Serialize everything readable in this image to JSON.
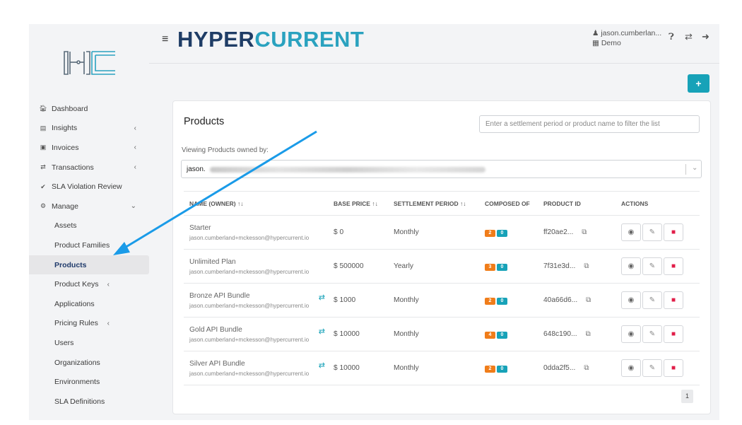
{
  "brand": {
    "part1": "HYPER",
    "part2": "CURRENT"
  },
  "user": {
    "name": "jason.cumberlan...",
    "org": "Demo"
  },
  "sidebar": {
    "items": [
      {
        "label": "Dashboard",
        "icon": "home-icon",
        "chevron": ""
      },
      {
        "label": "Insights",
        "icon": "bar-chart-icon",
        "chevron": "‹"
      },
      {
        "label": "Invoices",
        "icon": "invoice-icon",
        "chevron": "‹"
      },
      {
        "label": "Transactions",
        "icon": "transfer-icon",
        "chevron": "‹"
      },
      {
        "label": "SLA Violation Review",
        "icon": "check-icon",
        "chevron": ""
      },
      {
        "label": "Manage",
        "icon": "gear-icon",
        "chevron": "⌄"
      },
      {
        "label": "Assets",
        "chevron": ""
      },
      {
        "label": "Product Families",
        "chevron": ""
      },
      {
        "label": "Products",
        "chevron": "",
        "active": true
      },
      {
        "label": "Product Keys",
        "chevron": "‹"
      },
      {
        "label": "Applications",
        "chevron": ""
      },
      {
        "label": "Pricing Rules",
        "chevron": "‹"
      },
      {
        "label": "Users",
        "chevron": ""
      },
      {
        "label": "Organizations",
        "chevron": ""
      },
      {
        "label": "Environments",
        "chevron": ""
      },
      {
        "label": "SLA Definitions",
        "chevron": ""
      }
    ]
  },
  "products": {
    "title": "Products",
    "filter_placeholder": "Enter a settlement period or product name to filter the list",
    "owner_label": "Viewing Products owned by:",
    "owner_value": "jason.",
    "columns": {
      "name": "NAME (OWNER) ↑↓",
      "base_price": "BASE PRICE ↑↓",
      "settlement_period": "SETTLEMENT PERIOD ↑↓",
      "composed_of": "COMPOSED OF",
      "product_id": "PRODUCT ID",
      "actions": "ACTIONS"
    },
    "rows": [
      {
        "name": "Starter",
        "owner": "jason.cumberland+mckesson@hypercurrent.io",
        "price": "$ 0",
        "period": "Monthly",
        "c1": "2",
        "c2": "0",
        "id": "ff20ae2...",
        "sync": false
      },
      {
        "name": "Unlimited Plan",
        "owner": "jason.cumberland+mckesson@hypercurrent.io",
        "price": "$ 500000",
        "period": "Yearly",
        "c1": "3",
        "c2": "0",
        "id": "7f31e3d...",
        "sync": false
      },
      {
        "name": "Bronze API Bundle",
        "owner": "jason.cumberland+mckesson@hypercurrent.io",
        "price": "$ 1000",
        "period": "Monthly",
        "c1": "2",
        "c2": "0",
        "id": "40a66d6...",
        "sync": true
      },
      {
        "name": "Gold API Bundle",
        "owner": "jason.cumberland+mckesson@hypercurrent.io",
        "price": "$ 10000",
        "period": "Monthly",
        "c1": "4",
        "c2": "0",
        "id": "648c190...",
        "sync": true
      },
      {
        "name": "Silver API Bundle",
        "owner": "jason.cumberland+mckesson@hypercurrent.io",
        "price": "$ 10000",
        "period": "Monthly",
        "c1": "2",
        "c2": "0",
        "id": "0dda2f5...",
        "sync": true
      }
    ],
    "page": "1"
  },
  "colors": {
    "accent": "#17a2b8",
    "brand_dark": "#1f3d66",
    "orange": "#f07d1a",
    "danger": "#e11d48",
    "arrow": "#1a9be8"
  }
}
